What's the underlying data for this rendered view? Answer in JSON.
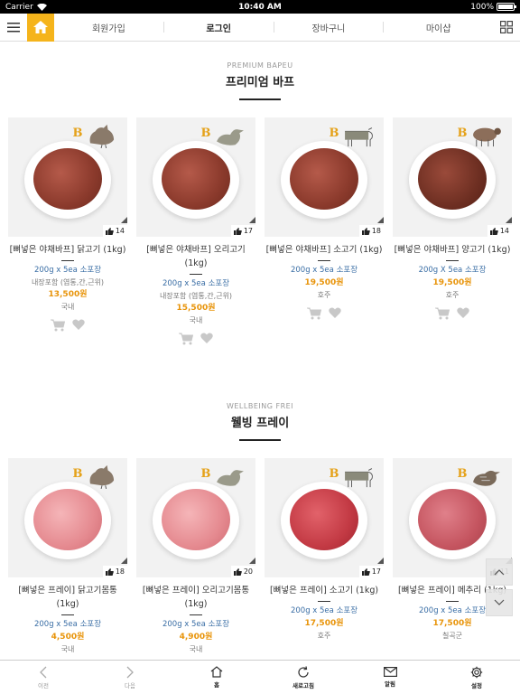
{
  "status": {
    "carrier": "Carrier",
    "time": "10:40 AM",
    "battery": "100%"
  },
  "nav": {
    "items": [
      "회원가입",
      "로그인",
      "장바구니",
      "마이샵"
    ]
  },
  "sections": [
    {
      "eng": "PREMIUM BAPEU",
      "kor": "프리미엄 바프",
      "products": [
        {
          "name": "[뼈넣은 야채바프] 닭고기 (1kg)",
          "spec": "200g x 5ea 소포장",
          "sub": "내장포함 (염통,간,근위)",
          "price": "13,500원",
          "origin": "국내",
          "likes": "14",
          "animal": "rooster-icon"
        },
        {
          "name": "[뼈넣은 야채바프] 오리고기 (1kg)",
          "spec": "200g x 5ea 소포장",
          "sub": "내장포함 (염통,간,근위)",
          "price": "15,500원",
          "origin": "국내",
          "likes": "17",
          "animal": "duck-icon"
        },
        {
          "name": "[뼈넣은 야채바프] 소고기 (1kg)",
          "spec": "200g x 5ea 소포장",
          "sub": "",
          "price": "19,500원",
          "origin": "호주",
          "likes": "18",
          "animal": "cow-icon"
        },
        {
          "name": "[뼈넣은 야채바프] 양고기 (1kg)",
          "spec": "200g X 5ea 소포장",
          "sub": "",
          "price": "19,500원",
          "origin": "호주",
          "likes": "14",
          "animal": "sheep-icon"
        }
      ]
    },
    {
      "eng": "WELLBEING FREI",
      "kor": "웰빙 프레이",
      "products": [
        {
          "name": "[뼈넣은 프레이] 닭고기몸통 (1kg)",
          "spec": "200g x 5ea 소포장",
          "sub": "",
          "price": "4,500원",
          "origin": "국내",
          "likes": "18",
          "animal": "rooster-icon"
        },
        {
          "name": "[뼈넣은 프레이] 오리고기몸통 (1kg)",
          "spec": "200g x 5ea 소포장",
          "sub": "",
          "price": "4,900원",
          "origin": "국내",
          "likes": "20",
          "animal": "duck-icon"
        },
        {
          "name": "[뼈넣은 프레이] 소고기 (1kg)",
          "spec": "200g x 5ea 소포장",
          "sub": "",
          "price": "17,500원",
          "origin": "호주",
          "likes": "17",
          "animal": "cow-icon"
        },
        {
          "name": "[뼈넣은 프레이] 메추리 (1kg)",
          "spec": "200g x 5ea 소포장",
          "sub": "",
          "price": "17,500원",
          "origin": "칠곡군",
          "likes": "11",
          "animal": "quail-icon"
        }
      ]
    }
  ],
  "bottom": {
    "items": [
      "이전",
      "다음",
      "홈",
      "새로고침",
      "알림",
      "설정"
    ]
  }
}
